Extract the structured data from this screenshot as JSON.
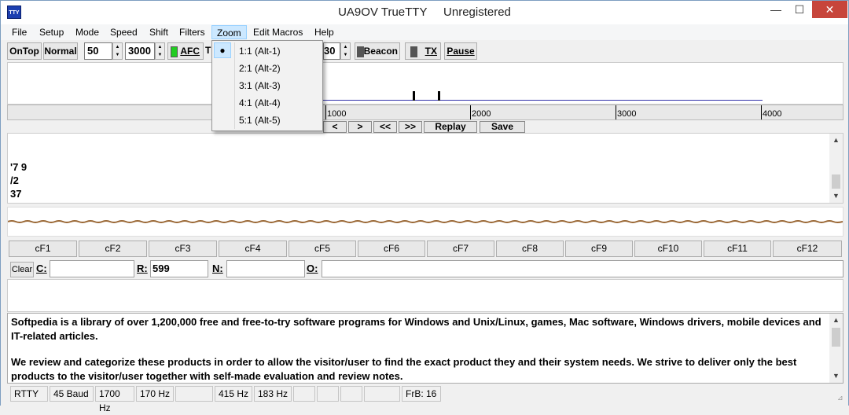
{
  "window": {
    "title": "UA9OV TrueTTY     Unregistered",
    "icon_text": "TTY",
    "minimize_icon": "minimize-icon",
    "maximize_icon": "maximize-icon",
    "close_icon": "close-icon"
  },
  "menu": [
    "File",
    "Setup",
    "Mode",
    "Speed",
    "Shift",
    "Filters",
    "Zoom",
    "Edit Macros",
    "Help"
  ],
  "toolbar": {
    "ontop": "OnTop",
    "normal": "Normal",
    "speed_value": "50",
    "freq_value": "3000",
    "afc": "AFC",
    "t_label": "T",
    "hidden_value": "30",
    "beacon": "Beacon",
    "tx": "TX",
    "pause": "Pause"
  },
  "ruler_ticks": [
    "1000",
    "2000",
    "3000",
    "4000"
  ],
  "controls": {
    "back": "<",
    "fwd": ">",
    "rew": "<<",
    "ffwd": ">>",
    "replay": "Replay",
    "save": "Save"
  },
  "rx_lines": [
    "'7 9",
    "/2",
    "37"
  ],
  "macros": [
    "cF1",
    "cF2",
    "cF3",
    "cF4",
    "cF5",
    "cF6",
    "cF7",
    "cF8",
    "cF9",
    "cF10",
    "cF11",
    "cF12"
  ],
  "log": {
    "clear": "Clear",
    "c_label": "C:",
    "c_value": "",
    "r_label": "R:",
    "r_value": "599",
    "n_label": "N:",
    "n_value": "",
    "o_label": "O:",
    "o_value": ""
  },
  "main_text": [
    "Softpedia is a library of over 1,200,000 free and free-to-try software programs for Windows and Unix/Linux, games, Mac software, Windows drivers, mobile devices and IT-related articles.",
    "We review and categorize these products in order to allow the visitor/user to find the exact product they and their system needs. We strive to deliver only the best products to the visitor/user together with self-made evaluation and review notes."
  ],
  "status": [
    "RTTY",
    "45 Baud",
    "1700 Hz",
    "170 Hz",
    "",
    "415 Hz",
    "183 Hz",
    "",
    "",
    "",
    "",
    "FrB: 16"
  ],
  "zoom_menu": {
    "items": [
      "1:1 (Alt-1)",
      "2:1 (Alt-2)",
      "3:1 (Alt-3)",
      "4:1 (Alt-4)",
      "5:1 (Alt-5)"
    ],
    "selected_marker": "●"
  },
  "colors": {
    "afc_led": "#22cc22",
    "beacon_led": "#555555",
    "tx_led": "#555555",
    "close_button": "#c7453b",
    "menu_highlight": "#cce8ff",
    "spectrum_line": "#3333aa",
    "scope_trace": "#996633"
  }
}
